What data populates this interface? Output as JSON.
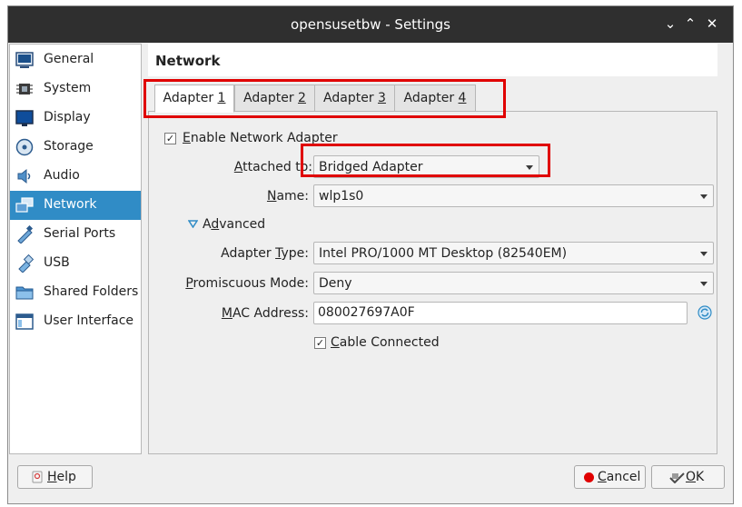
{
  "window": {
    "title": "opensusetbw - Settings"
  },
  "titlebar": {
    "minimize": "⌄",
    "restore": "⌃",
    "close": "✕"
  },
  "sidebar": {
    "items": [
      {
        "label": "General",
        "icon": "general-icon"
      },
      {
        "label": "System",
        "icon": "system-chip-icon"
      },
      {
        "label": "Display",
        "icon": "display-monitor-icon"
      },
      {
        "label": "Storage",
        "icon": "storage-disk-icon"
      },
      {
        "label": "Audio",
        "icon": "audio-speaker-icon"
      },
      {
        "label": "Network",
        "icon": "network-icon",
        "selected": true
      },
      {
        "label": "Serial Ports",
        "icon": "serial-port-icon"
      },
      {
        "label": "USB",
        "icon": "usb-icon"
      },
      {
        "label": "Shared Folders",
        "icon": "shared-folder-icon"
      },
      {
        "label": "User Interface",
        "icon": "user-interface-icon"
      }
    ]
  },
  "page": {
    "title": "Network"
  },
  "tabs": [
    {
      "prefix": "Adapter ",
      "key": "1",
      "active": true
    },
    {
      "prefix": "Adapter ",
      "key": "2",
      "active": false
    },
    {
      "prefix": "Adapter ",
      "key": "3",
      "active": false
    },
    {
      "prefix": "Adapter ",
      "key": "4",
      "active": false
    }
  ],
  "adapter": {
    "enable": {
      "key": "E",
      "rest": "nable Network Adapter",
      "checked": true
    },
    "attached_to": {
      "key": "A",
      "rest": "ttached to:",
      "value": "Bridged Adapter"
    },
    "name": {
      "key": "N",
      "rest": "ame:",
      "value": "wlp1s0"
    },
    "advanced": {
      "key": "d",
      "pre": "A",
      "rest": "vanced",
      "expanded": true
    },
    "adapter_type": {
      "pre": "Adapter ",
      "key": "T",
      "rest": "ype:",
      "value": "Intel PRO/1000 MT Desktop (82540EM)"
    },
    "promiscuous": {
      "key": "P",
      "rest": "romiscuous Mode:",
      "value": "Deny"
    },
    "mac": {
      "key": "M",
      "rest": "AC Address:",
      "value": "080027697A0F"
    },
    "cable": {
      "key": "C",
      "rest": "able Connected",
      "checked": true
    }
  },
  "buttons": {
    "help": {
      "key": "H",
      "rest": "elp"
    },
    "cancel": {
      "key": "C",
      "rest": "ancel"
    },
    "ok": {
      "key": "O",
      "rest": "K"
    }
  },
  "colors": {
    "selection": "#308cc6",
    "highlight": "#e00000",
    "titlebar": "#2f2f2f"
  }
}
